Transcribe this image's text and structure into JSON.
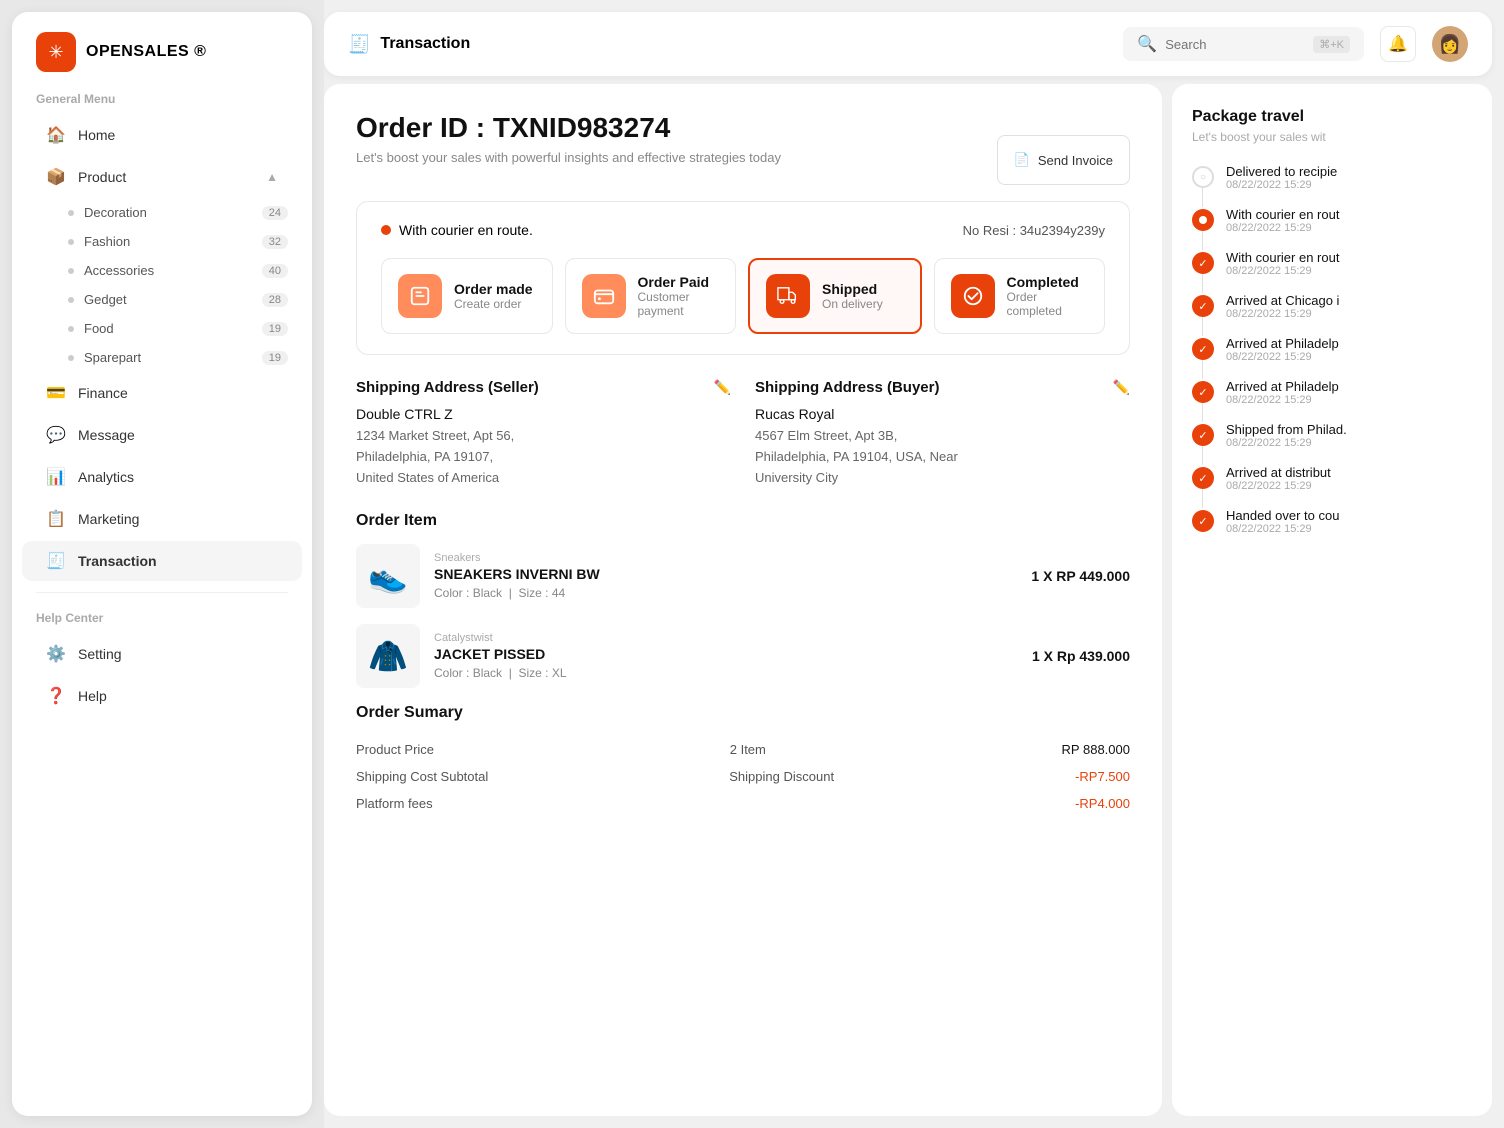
{
  "app": {
    "name": "OPENSALES",
    "trademark": "®"
  },
  "sidebar": {
    "general_menu_label": "General Menu",
    "help_center_label": "Help Center",
    "nav_items": [
      {
        "id": "home",
        "label": "Home",
        "icon": "🏠",
        "active": false
      },
      {
        "id": "product",
        "label": "Product",
        "icon": "📦",
        "active": false,
        "has_children": true,
        "children": [
          {
            "label": "Decoration",
            "badge": "24"
          },
          {
            "label": "Fashion",
            "badge": "32"
          },
          {
            "label": "Accessories",
            "badge": "40"
          },
          {
            "label": "Gedget",
            "badge": "28"
          },
          {
            "label": "Food",
            "badge": "19"
          },
          {
            "label": "Sparepart",
            "badge": "19"
          }
        ]
      },
      {
        "id": "finance",
        "label": "Finance",
        "icon": "💳",
        "active": false
      },
      {
        "id": "message",
        "label": "Message",
        "icon": "💬",
        "active": false
      },
      {
        "id": "analytics",
        "label": "Analytics",
        "icon": "📊",
        "active": false
      },
      {
        "id": "marketing",
        "label": "Marketing",
        "icon": "📋",
        "active": false
      },
      {
        "id": "transaction",
        "label": "Transaction",
        "icon": "🧾",
        "active": true
      }
    ],
    "help_items": [
      {
        "id": "setting",
        "label": "Setting",
        "icon": "⚙️"
      },
      {
        "id": "help",
        "label": "Help",
        "icon": "❓"
      }
    ]
  },
  "topbar": {
    "title": "Transaction",
    "title_icon": "🧾",
    "search_placeholder": "Search",
    "search_shortcut": "⌘+K",
    "bell_icon": "🔔"
  },
  "order": {
    "id_label": "Order ID : TXNID983274",
    "subtitle": "Let's boost your sales with powerful insights and effective strategies today",
    "send_invoice_label": "Send Invoice",
    "tracking": {
      "status": "With courier en route.",
      "resi_label": "No Resi : 34u2394y239y",
      "steps": [
        {
          "id": "order_made",
          "title": "Order made",
          "sub": "Create order",
          "active": false
        },
        {
          "id": "order_paid",
          "title": "Order Paid",
          "sub": "Customer payment",
          "active": false
        },
        {
          "id": "shipped",
          "title": "Shipped",
          "sub": "On delivery",
          "active": true
        },
        {
          "id": "completed",
          "title": "Completed",
          "sub": "Order completed",
          "active": false
        }
      ]
    },
    "seller_address": {
      "title": "Shipping Address (Seller)",
      "name": "Double CTRL  Z",
      "line1": "1234 Market Street, Apt 56,",
      "line2": "Philadelphia, PA 19107,",
      "line3": "United States of America"
    },
    "buyer_address": {
      "title": "Shipping Address (Buyer)",
      "name": "Rucas Royal",
      "line1": "4567 Elm Street,  Apt 3B,",
      "line2": "Philadelphia, PA 19104, USA, Near",
      "line3": "University City"
    },
    "order_item_label": "Order Item",
    "items": [
      {
        "category": "Sneakers",
        "name": "SNEAKERS INVERNI BW",
        "color": "Black",
        "size": "44",
        "qty": "1 X RP 449.000",
        "emoji": "👟"
      },
      {
        "category": "Catalystwist",
        "name": "JACKET PISSED",
        "color": "Black",
        "size": "XL",
        "qty": "1 X Rp 439.000",
        "emoji": "🧥"
      }
    ],
    "summary": {
      "title": "Order Sumary",
      "rows": [
        {
          "label": "Product Price",
          "mid": "2 Item",
          "value": "RP 888.000",
          "red": false
        },
        {
          "label": "Shipping Cost Subtotal",
          "mid": "Shipping Discount",
          "value": "-RP7.500",
          "red": true
        },
        {
          "label": "Platform fees",
          "mid": "",
          "value": "-RP4.000",
          "red": true
        }
      ]
    }
  },
  "right_panel": {
    "title": "Package travel",
    "subtitle": "Let's boost your sales wit",
    "timeline": [
      {
        "status": "loading",
        "title": "Delivered to recipie",
        "time": "08/22/2022 15:29"
      },
      {
        "status": "current",
        "title": "With courier en rout",
        "time": "08/22/2022 15:29"
      },
      {
        "status": "done",
        "title": "With courier en rout",
        "time": "08/22/2022 15:29"
      },
      {
        "status": "done",
        "title": "Arrived at Chicago i",
        "time": "08/22/2022 15:29"
      },
      {
        "status": "done",
        "title": "Arrived at Philadelp",
        "time": "08/22/2022 15:29"
      },
      {
        "status": "done",
        "title": "Arrived at Philadelp",
        "time": "08/22/2022 15:29"
      },
      {
        "status": "done",
        "title": "Shipped from Philad.",
        "time": "08/22/2022 15:29"
      },
      {
        "status": "done",
        "title": "Arrived at distribut",
        "time": "08/22/2022 15:29"
      },
      {
        "status": "done",
        "title": "Handed over to cou",
        "time": "08/22/2022 15:29"
      }
    ]
  }
}
